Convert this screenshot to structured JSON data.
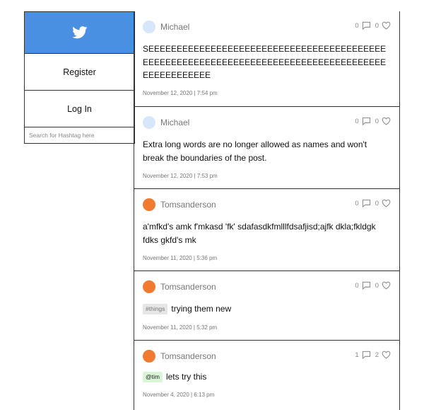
{
  "sidebar": {
    "logo_icon": "twitter-bird-icon",
    "accent": "#4a90e2",
    "register_label": "Register",
    "login_label": "Log In",
    "search_placeholder": "Search for Hashtag here"
  },
  "posts": [
    {
      "username": "Michael",
      "avatar_color": "#d6e6fb",
      "comment_count": "0",
      "like_count": "0",
      "content": "SEEEEEEEEEEEEEEEEEEEEEEEEEEEEEEEEEEEEEEEEEEEEEEEEEEEEEEEEEEEEEEEEEEEEEEEEEEEEEEEEEEEEEEEEEEEEEEEEE",
      "timestamp": "November 12, 2020 | 7:54 pm"
    },
    {
      "username": "Michael",
      "avatar_color": "#d6e6fb",
      "comment_count": "0",
      "like_count": "0",
      "content": "Extra long words are no longer allowed as names and won't break the boundaries of the post.",
      "timestamp": "November 12, 2020 | 7:53 pm"
    },
    {
      "username": "Tomsanderson",
      "avatar_color": "#f07a30",
      "comment_count": "0",
      "like_count": "0",
      "content": "a'mfkd's amk f'mkasd 'fk' sdafasdkfmlllfdsafjisd;ajfk dkla;fkldgk fdks gkfd's mk",
      "timestamp": "November 11, 2020 | 5:36 pm"
    },
    {
      "username": "Tomsanderson",
      "avatar_color": "#f07a30",
      "comment_count": "0",
      "like_count": "0",
      "tag": "#things",
      "content": "trying them new",
      "timestamp": "November 11, 2020 | 5:32 pm"
    },
    {
      "username": "Tomsanderson",
      "avatar_color": "#f07a30",
      "comment_count": "1",
      "like_count": "2",
      "tag": "@tim",
      "content": "lets try this",
      "timestamp": "November 4, 2020 | 6:13 pm"
    }
  ]
}
